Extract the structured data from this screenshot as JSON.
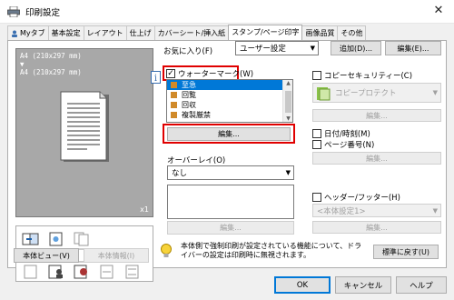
{
  "window": {
    "title": "印刷設定",
    "close_glyph": "✕"
  },
  "tabs": [
    {
      "label": "Myタブ"
    },
    {
      "label": "基本設定"
    },
    {
      "label": "レイアウト"
    },
    {
      "label": "仕上げ"
    },
    {
      "label": "カバーシート/挿入紙"
    },
    {
      "label": "スタンプ/ページ印字"
    },
    {
      "label": "画像品質"
    },
    {
      "label": "その他"
    }
  ],
  "preview": {
    "paper_info": "A4 (210x297 mm)\n▼\nA4 (210x297 mm)",
    "scale": "x1"
  },
  "left_buttons": {
    "device_view": "本体ビュー(V)",
    "device_info": "本体情報(I)"
  },
  "favorites": {
    "label": "お気に入り(F)",
    "value": "ユーザー設定",
    "add": "追加(D)...",
    "edit": "編集(E)..."
  },
  "watermark": {
    "label": "ウォーターマーク(W)",
    "items": [
      "至急",
      "回覧",
      "回収",
      "複製厳禁"
    ],
    "edit": "編集..."
  },
  "overlay": {
    "label": "オーバーレイ(O)",
    "value": "なし",
    "edit": "編集..."
  },
  "copy_security": {
    "label": "コピーセキュリティー(C)",
    "value": "コピープロテクト",
    "edit": "編集..."
  },
  "date_time": {
    "label": "日付/時刻(M)"
  },
  "page_number": {
    "label": "ページ番号(N)",
    "edit": "編集..."
  },
  "header_footer": {
    "label": "ヘッダー/フッター(H)",
    "value": "<本体設定1>",
    "edit": "編集..."
  },
  "notice": {
    "text": "本体側で強制印刷が設定されている機能について、ドライバーの設定は印刷時に無視されます。",
    "restore": "標準に戻す(U)"
  },
  "footer": {
    "ok": "OK",
    "cancel": "キャンセル",
    "help": "ヘルプ"
  },
  "colors": {
    "highlight": "#e00000",
    "selection": "#0078d7"
  }
}
